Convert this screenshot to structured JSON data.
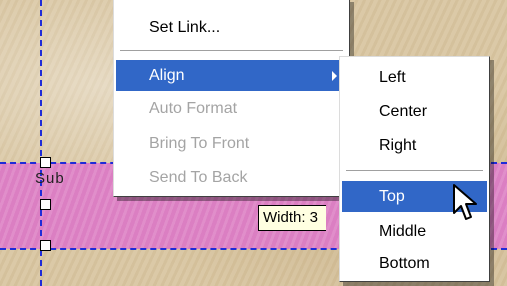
{
  "context_menu": {
    "items": [
      {
        "label": "Set Link...",
        "state": "normal"
      },
      {
        "label": "Align",
        "state": "selected",
        "has_submenu": true
      },
      {
        "label": "Auto Format",
        "state": "disabled"
      },
      {
        "label": "Bring To Front",
        "state": "disabled"
      },
      {
        "label": "Send To Back",
        "state": "disabled"
      }
    ]
  },
  "align_submenu": {
    "items": [
      {
        "label": "Left"
      },
      {
        "label": "Center"
      },
      {
        "label": "Right"
      },
      {
        "label": "Top",
        "state": "selected"
      },
      {
        "label": "Middle"
      },
      {
        "label": "Bottom"
      }
    ]
  },
  "canvas": {
    "object_text": "Sub",
    "tooltip": "Width: 3"
  },
  "colors": {
    "menu_highlight": "#3167c7",
    "selection_dash": "#1f2bd8",
    "pink_object": "#de84c6",
    "background": "#d9c6a2",
    "tooltip_bg": "#ffffe1"
  },
  "icons": [
    "submenu-arrow-icon",
    "mouse-pointer-icon"
  ]
}
